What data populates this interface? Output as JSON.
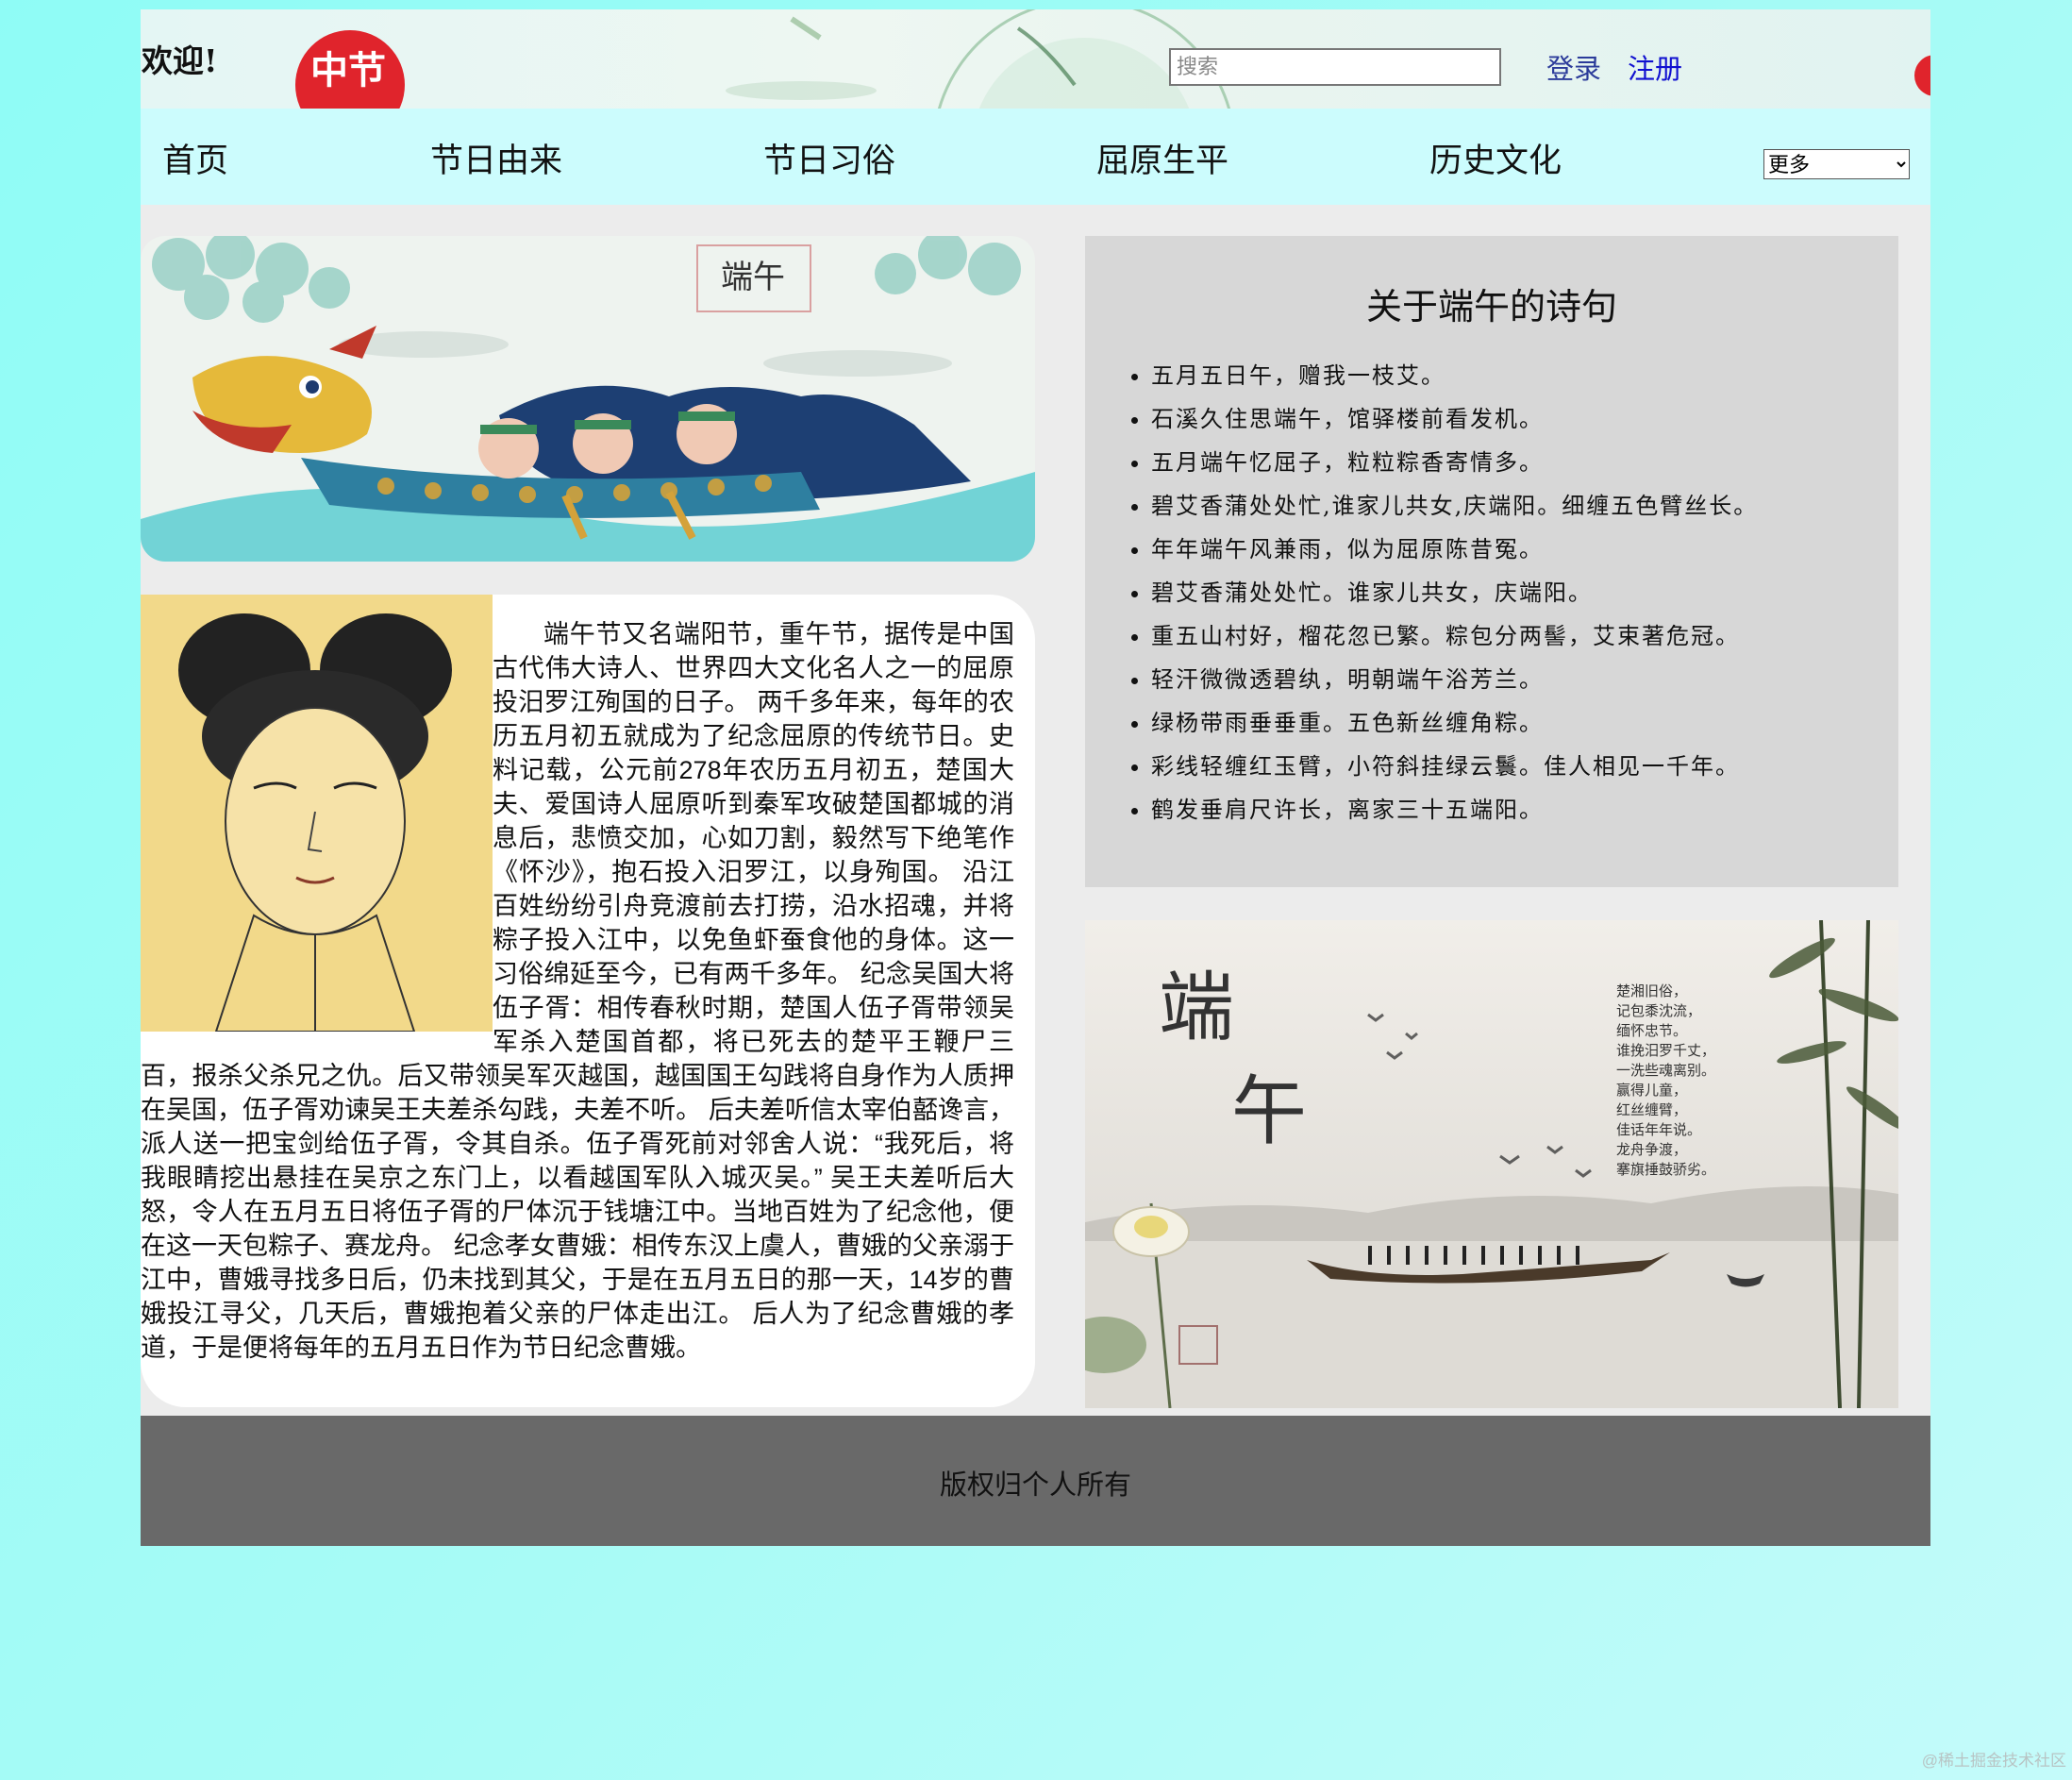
{
  "header": {
    "welcome": "欢迎!",
    "search_placeholder": "搜索",
    "login": "登录",
    "register": "注册",
    "banner_logo_text": "中节"
  },
  "nav": {
    "items": [
      "首页",
      "节日由来",
      "节日习俗",
      "屈原生平",
      "历史文化"
    ],
    "more_selected": "更多"
  },
  "hero": {
    "badge_text": "端午"
  },
  "article": {
    "text": "端午节又名端阳节，重午节，据传是中国古代伟大诗人、世界四大文化名人之一的屈原投汨罗江殉国的日子。 两千多年来，每年的农历五月初五就成为了纪念屈原的传统节日。史料记载，公元前278年农历五月初五，楚国大夫、爱国诗人屈原听到秦军攻破楚国都城的消息后，悲愤交加，心如刀割，毅然写下绝笔作《怀沙》，抱石投入汨罗江，以身殉国。 沿江百姓纷纷引舟竞渡前去打捞，沿水招魂，并将粽子投入江中，以免鱼虾蚕食他的身体。这一习俗绵延至今，已有两千多年。 纪念吴国大将伍子胥：相传春秋时期，楚国人伍子胥带领吴军杀入楚国首都，将已死去的楚平王鞭尸三百，报杀父杀兄之仇。后又带领吴军灭越国，越国国王勾践将自身作为人质押在吴国，伍子胥劝谏吴王夫差杀勾践，夫差不听。 后夫差听信太宰伯嚭谗言，派人送一把宝剑给伍子胥，令其自杀。伍子胥死前对邻舍人说：“我死后，将我眼睛挖出悬挂在吴京之东门上，以看越国军队入城灭吴。” 吴王夫差听后大怒，令人在五月五日将伍子胥的尸体沉于钱塘江中。当地百姓为了纪念他，便在这一天包粽子、赛龙舟。 纪念孝女曹娥：相传东汉上虞人，曹娥的父亲溺于江中，曹娥寻找多日后，仍未找到其父，于是在五月五日的那一天，14岁的曹娥投江寻父，几天后，曹娥抱着父亲的尸体走出江。 后人为了纪念曹娥的孝道，于是便将每年的五月五日作为节日纪念曹娥。"
  },
  "poems": {
    "title": "关于端午的诗句",
    "items": [
      "五月五日午，赠我一枝艾。",
      "石溪久住思端午，馆驿楼前看发机。",
      "五月端午忆屈子，粒粒粽香寄情多。",
      "碧艾香蒲处处忙,谁家儿共女,庆端阳。细缠五色臂丝长。",
      "年年端午风兼雨，似为屈原陈昔冤。",
      "碧艾香蒲处处忙。谁家儿共女，庆端阳。",
      "重五山村好，榴花忽已繁。粽包分两髻，艾束著危冠。",
      "轻汗微微透碧纨，明朝端午浴芳兰。",
      "绿杨带雨垂垂重。五色新丝缠角粽。",
      "彩线轻缠红玉臂，小符斜挂绿云鬟。佳人相见一千年。",
      "鹤发垂肩尺许长，离家三十五端阳。"
    ]
  },
  "ink_painting": {
    "title_chars": [
      "端",
      "午"
    ],
    "verse_lines": [
      "楚湘旧俗，",
      "记包黍沈流，",
      "缅怀忠节。",
      "谁挽汨罗千丈，",
      "一洗些魂离别。",
      "赢得儿童，",
      "红丝缠臂，",
      "佳话年年说。",
      "龙舟争渡，",
      "搴旗捶鼓骄劣。"
    ]
  },
  "footer": {
    "copyright": "版权归个人所有"
  },
  "watermark": "@稀土掘金技术社区",
  "colors": {
    "page_bg": "#a8fbf6",
    "nav_bg": "#ccfcfd",
    "main_bg": "#ececec",
    "poems_bg": "#d7d7d7",
    "footer_bg": "#696969",
    "login_link": "#2b3b9a",
    "register_link": "#1010d0"
  }
}
